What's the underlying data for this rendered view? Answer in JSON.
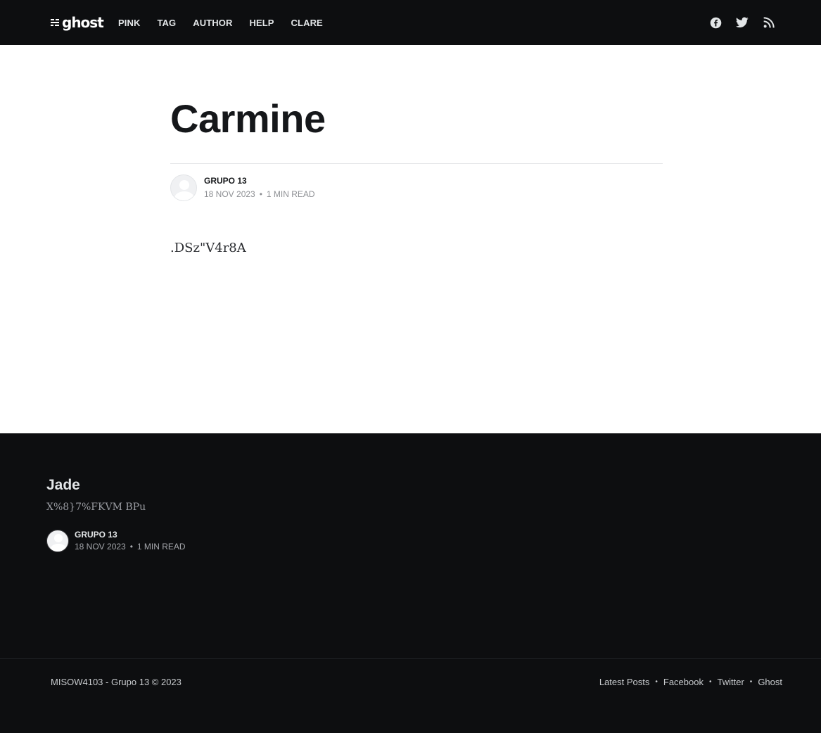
{
  "header": {
    "logo_text": "ghost",
    "nav": [
      {
        "label": "PINK"
      },
      {
        "label": "TAG"
      },
      {
        "label": "AUTHOR"
      },
      {
        "label": "HELP"
      },
      {
        "label": "CLARE"
      }
    ],
    "social_icons": [
      "facebook-icon",
      "twitter-icon",
      "rss-icon"
    ]
  },
  "article": {
    "title": "Carmine",
    "author": "GRUPO 13",
    "date": "18 NOV 2023",
    "reading_time": "1 MIN READ",
    "body": ".DSz\"V4r8A"
  },
  "feed": {
    "title": "Jade",
    "excerpt": "X%8}7%FKVM BPu",
    "author": "GRUPO 13",
    "date": "18 NOV 2023",
    "reading_time": "1 MIN READ"
  },
  "footer": {
    "copyright": "MISOW4103 - Grupo 13 © 2023",
    "links": [
      {
        "label": "Latest Posts"
      },
      {
        "label": "Facebook"
      },
      {
        "label": "Twitter"
      },
      {
        "label": "Ghost"
      }
    ]
  },
  "colors": {
    "header_bg": "#0d0e10",
    "footer_bg": "#0d0e10"
  }
}
